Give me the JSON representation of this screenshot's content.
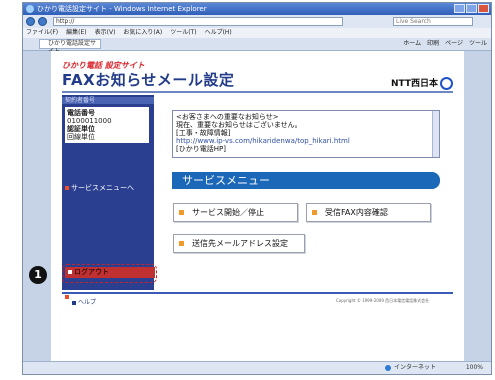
{
  "browser": {
    "title": "ひかり電話設定サイト - Windows Internet Explorer",
    "address": "http://",
    "search_placeholder": "Live Search",
    "menu": [
      "ファイル(F)",
      "編集(E)",
      "表示(V)",
      "お気に入り(A)",
      "ツール(T)",
      "ヘルプ(H)"
    ],
    "tab_label": "ひかり電話設定サイト",
    "commands": [
      "ホーム",
      "印刷",
      "ページ",
      "ツール"
    ],
    "status_zone": "インターネット",
    "zoom": "100%"
  },
  "header": {
    "subtitle": "ひかり電話 設定サイト",
    "title": "FAXお知らせメール設定",
    "brand": "NTT西日本"
  },
  "sidebar": {
    "section_label": "契約者番号",
    "phone_label": "電話番号",
    "phone_value": "0100011000",
    "unit_label": "認証単位",
    "unit_value": "回線単位",
    "service_menu_link": "サービスメニューへ",
    "top_link": "設定サイト トップ",
    "logout_link": "ログアウト"
  },
  "callout_number": "1",
  "notice": {
    "line1": "<お客さまへの重要なお知らせ>",
    "line2": "現在、重要なお知らせはございません。",
    "line3": "[工事・故障情報]",
    "line4": "http://www.ip-vs.com/hikaridenwa/top_hikari.html",
    "line5": "[ひかり電話HP]"
  },
  "service_menu": {
    "heading": "サービスメニュー",
    "start_stop": "サービス開始／停止",
    "received_fax": "受信FAX内容確認",
    "mail_address": "送信先メールアドレス設定"
  },
  "footer": {
    "help": "ヘルプ",
    "copyright": "Copyright © 1999-2009 西日本電信電話株式会社"
  }
}
